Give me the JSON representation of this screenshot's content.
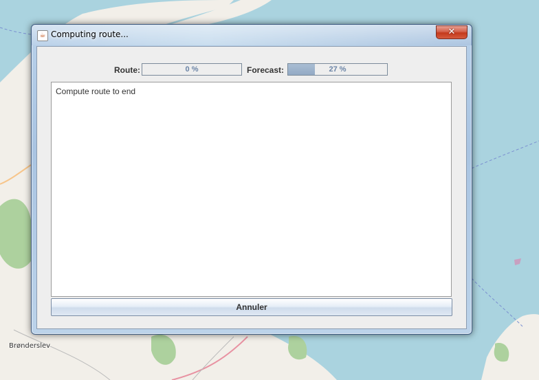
{
  "window": {
    "title": "Computing route...",
    "close_label": "✕"
  },
  "progress": {
    "route_label": "Route:",
    "route_value_text": "0 %",
    "route_fraction": 0,
    "forecast_label": "Forecast:",
    "forecast_value_text": "27 %",
    "forecast_fraction": 0.27
  },
  "log": {
    "text": "Compute route to end"
  },
  "buttons": {
    "cancel_label": "Annuler"
  },
  "map": {
    "place_label": "Brønderslev",
    "colors": {
      "water": "#aad3df",
      "land": "#f2efe9",
      "forest": "#add19e"
    }
  },
  "colors": {
    "progress_fill": "#93aac5",
    "progress_text": "#6b84a6",
    "close_button": "#c4391c"
  }
}
